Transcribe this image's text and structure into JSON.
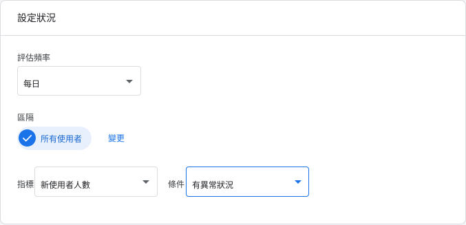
{
  "card": {
    "title": "設定狀況"
  },
  "frequency": {
    "label": "評估頻率",
    "selected": "每日"
  },
  "scope": {
    "label": "區隔",
    "chip_label": "所有使用者",
    "change_link": "變更"
  },
  "metric": {
    "label": "指標",
    "selected": "新使用者人數"
  },
  "condition": {
    "label": "條件",
    "selected": "有異常狀況"
  },
  "colors": {
    "accent": "#1a73e8",
    "chip_bg": "#e8f0fe",
    "border": "#dadce0"
  },
  "icons": {
    "dropdown": "caret-down-icon",
    "check": "check-icon"
  }
}
